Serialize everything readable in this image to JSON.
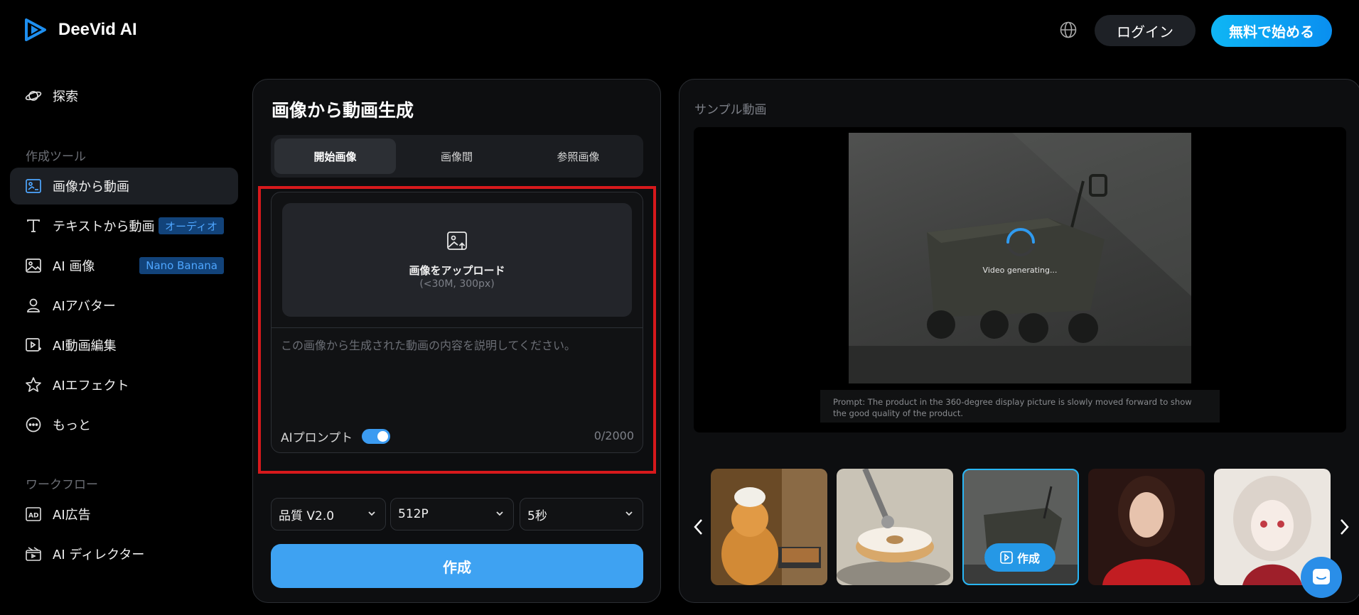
{
  "brand": {
    "name": "DeeVid AI",
    "accent": "#1e8ff0"
  },
  "header": {
    "login_label": "ログイン",
    "start_label": "無料で始める",
    "language_icon": "globe-icon"
  },
  "sidebar": {
    "explore": {
      "label": "探索",
      "icon": "planet-icon"
    },
    "tools_section": "作成ツール",
    "tools": [
      {
        "label": "画像から動画",
        "icon": "image-to-video-icon",
        "active": true
      },
      {
        "label": "テキストから動画",
        "icon": "text-icon",
        "badge": "オーディオ"
      },
      {
        "label": "AI 画像",
        "icon": "image-icon",
        "badge": "Nano Banana"
      },
      {
        "label": "AIアバター",
        "icon": "avatar-icon"
      },
      {
        "label": "AI動画編集",
        "icon": "video-edit-icon"
      },
      {
        "label": "AIエフェクト",
        "icon": "star-icon"
      },
      {
        "label": "もっと",
        "icon": "more-icon"
      }
    ],
    "workflow_section": "ワークフロー",
    "workflows": [
      {
        "label": "AI広告",
        "icon": "ad-icon"
      },
      {
        "label": "AI ディレクター",
        "icon": "director-icon"
      }
    ]
  },
  "generator": {
    "title": "画像から動画生成",
    "tabs": [
      "開始画像",
      "画像間",
      "参照画像"
    ],
    "active_tab": 0,
    "upload_label": "画像をアップロード",
    "upload_hint": "(<30M, 300px)",
    "prompt_placeholder": "この画像から生成された動画の内容を説明してください。",
    "prompt_value": "",
    "ai_prompt_label": "AIプロンプト",
    "ai_prompt_enabled": true,
    "char_count": "0/2000",
    "quality": "品質 V2.0",
    "resolution": "512P",
    "duration": "5秒",
    "create_label": "作成"
  },
  "samples": {
    "title": "サンプル動画",
    "status": "Video generating...",
    "prompt_prefix": "Prompt:",
    "prompt_text": "The product in the 360-degree display picture is slowly moved forward to show the good quality of the product.",
    "thumb_action": "作成",
    "thumbnails": [
      "orange-cat-chef",
      "donut-robot",
      "camping-wagon",
      "woman-red-sweater",
      "anime-girl"
    ],
    "active_thumb": 2
  }
}
